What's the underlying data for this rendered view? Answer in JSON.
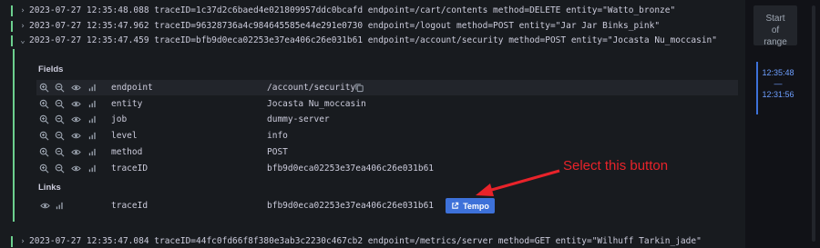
{
  "log_lines": [
    {
      "text": "2023-07-27 12:35:48.088 traceID=1c37d2c6baed4e021809957ddc0bcafd endpoint=/cart/contents method=DELETE entity=\"Watto_bronze\"",
      "expanded": false
    },
    {
      "text": "2023-07-27 12:35:47.962 traceID=96328736a4c984645585e44e291e0730 endpoint=/logout method=POST entity=\"Jar Jar Binks_pink\"",
      "expanded": false
    },
    {
      "text": "2023-07-27 12:35:47.459 traceID=bfb9d0eca02253e37ea406c26e031b61 endpoint=/account/security method=POST entity=\"Jocasta Nu_moccasin\"",
      "expanded": true
    },
    {
      "text": "2023-07-27 12:35:47.084 traceID=44fc0fd66f8f380e3ab3c2230c467cb2 endpoint=/metrics/server method=GET entity=\"Wilhuff Tarkin_jade\"",
      "expanded": false
    }
  ],
  "fields_title": "Fields",
  "fields": [
    {
      "key": "endpoint",
      "value": "/account/security"
    },
    {
      "key": "entity",
      "value": "Jocasta Nu_moccasin"
    },
    {
      "key": "job",
      "value": "dummy-server"
    },
    {
      "key": "level",
      "value": "info"
    },
    {
      "key": "method",
      "value": "POST"
    },
    {
      "key": "traceID",
      "value": "bfb9d0eca02253e37ea406c26e031b61"
    }
  ],
  "links_title": "Links",
  "link": {
    "key": "traceId",
    "value": "bfb9d0eca02253e37ea406c26e031b61",
    "button_label": "Tempo"
  },
  "annotation": "Select this button",
  "right_panel": {
    "start_line1": "Start",
    "start_line2": "of",
    "start_line3": "range",
    "range_end": "12:35:48",
    "range_sep": "—",
    "range_start": "12:31:56"
  },
  "colors": {
    "level_bar": "#6ccf8e",
    "button": "#3d71d9",
    "annotation": "#e8232a",
    "range_text": "#6e9fff"
  }
}
